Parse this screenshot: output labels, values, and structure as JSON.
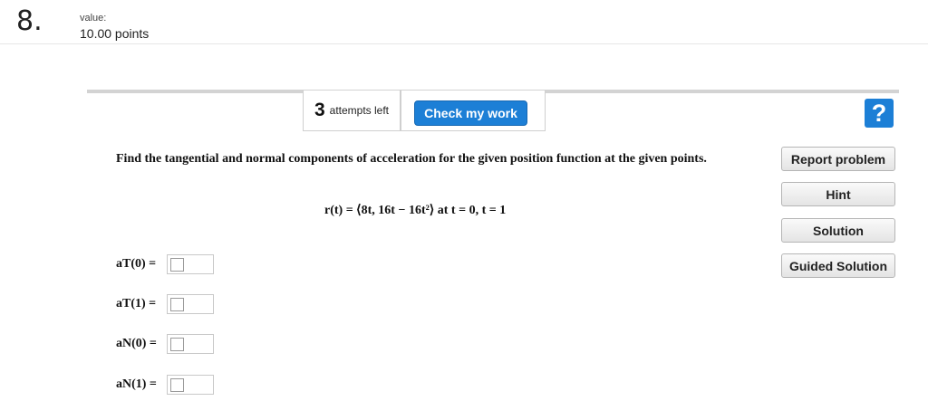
{
  "question": {
    "number": "8.",
    "value_label": "value:",
    "points": "10.00 points",
    "text": "Find the tangential and normal components of acceleration for the given position function at the given points.",
    "formula": "r(t) = ⟨8t, 16t − 16t²⟩ at t = 0, t = 1"
  },
  "toolbar": {
    "attempts_count": "3",
    "attempts_text": "attempts left",
    "check_label": "Check my work",
    "help_glyph": "?"
  },
  "side_buttons": {
    "report": "Report problem",
    "hint": "Hint",
    "solution": "Solution",
    "guided": "Guided Solution"
  },
  "answers": [
    {
      "label": "aT(0) =",
      "value": ""
    },
    {
      "label": "aT(1) =",
      "value": ""
    },
    {
      "label": "aN(0) =",
      "value": ""
    },
    {
      "label": "aN(1) =",
      "value": ""
    }
  ],
  "colors": {
    "accent": "#1c7fd6"
  },
  "icons": {
    "help": "question-mark-icon"
  }
}
